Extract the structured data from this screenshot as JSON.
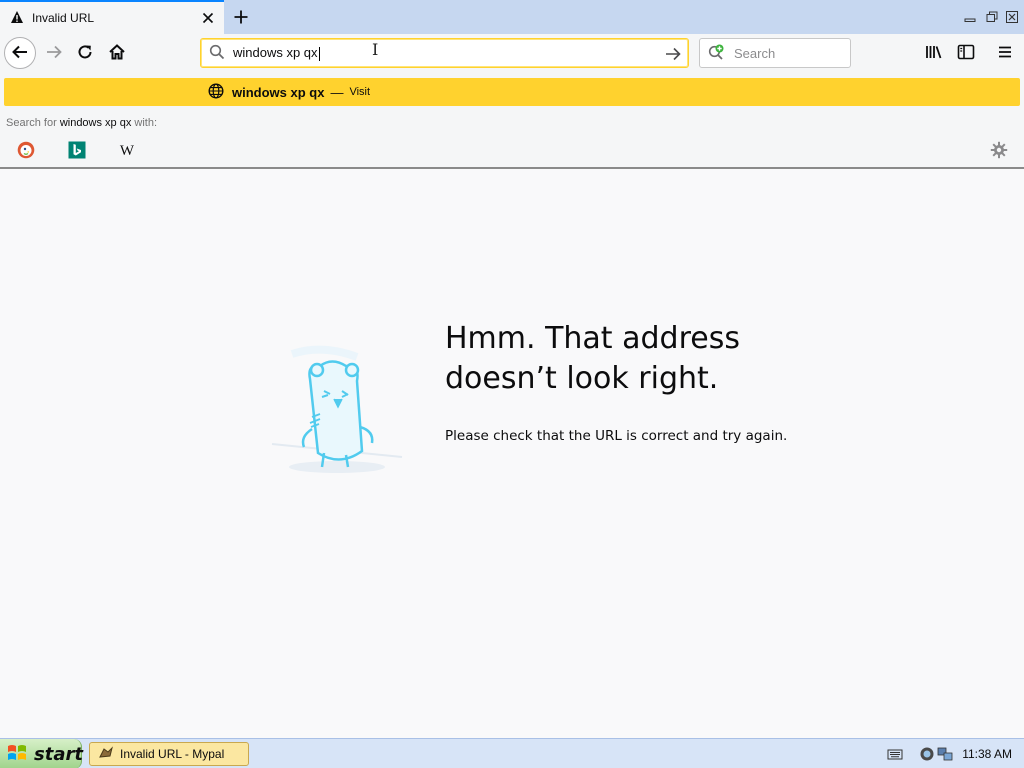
{
  "tab": {
    "title": "Invalid URL",
    "icon": "warning-icon"
  },
  "navbar": {
    "url_value": "windows xp qx",
    "search_placeholder": "Search"
  },
  "popup": {
    "result_title": "windows xp qx",
    "result_separator": "—",
    "result_action": "Visit",
    "search_with_prefix": "Search for ",
    "search_with_term": "windows xp qx",
    "search_with_suffix": " with:",
    "engines": [
      "DuckDuckGo",
      "Bing",
      "Wikipedia"
    ],
    "wikipedia_glyph": "W"
  },
  "error": {
    "title_line1": "Hmm. That address",
    "title_line2": "doesn’t look right.",
    "description": "Please check that the URL is correct and try again."
  },
  "taskbar": {
    "start_label": "start",
    "task_label": "Invalid URL - Mypal",
    "clock": "11:38 AM"
  },
  "colors": {
    "accent": "#0a84ff",
    "highlight": "#ffd22e",
    "taskbar": "#d7e4f7"
  }
}
